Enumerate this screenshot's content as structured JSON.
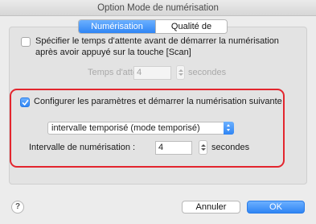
{
  "window": {
    "title": "Option Mode de numérisation"
  },
  "tabs": [
    {
      "label": "Numérisation",
      "active": true
    },
    {
      "label": "Qualité de l'image",
      "active": false
    }
  ],
  "wait_option": {
    "checked": false,
    "label_line1": "Spécifier le temps d'attente avant de démarrer la numérisation",
    "label_line2": "après avoir appuyé sur la touche [Scan]",
    "field_label": "Temps d'attente :",
    "value": "4",
    "unit": "secondes"
  },
  "configure_option": {
    "checked": true,
    "label": "Configurer les paramètres et démarrer la numérisation suivante",
    "mode_select": "intervalle temporisé (mode temporisé)",
    "interval_label": "Intervalle de numérisation :",
    "interval_value": "4",
    "unit": "secondes"
  },
  "buttons": {
    "help": "?",
    "cancel": "Annuler",
    "ok": "OK"
  },
  "colors": {
    "accent": "#2f85f4",
    "highlight": "#e3262e"
  }
}
